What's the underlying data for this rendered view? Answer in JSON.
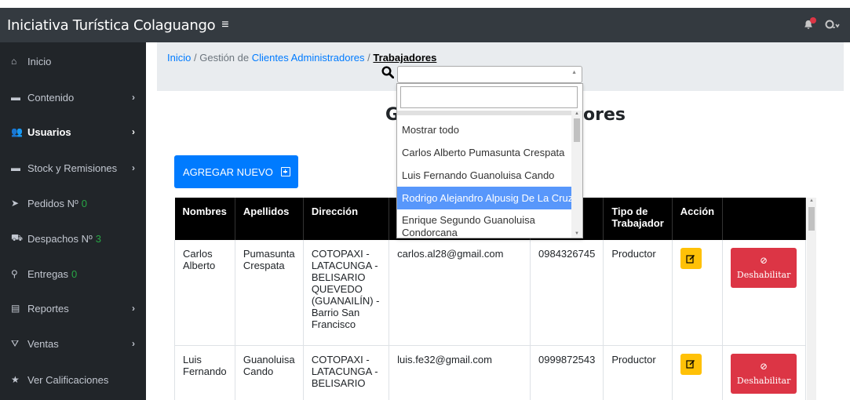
{
  "app": {
    "title": "Iniciativa Turística Colaguango",
    "menu_icon": "≡"
  },
  "sidebar": {
    "items": [
      {
        "label": "Inicio",
        "icon": "home-icon",
        "glyph": "⌂",
        "chevron": ""
      },
      {
        "label": "Contenido",
        "icon": "folder-icon",
        "glyph": "▬",
        "chevron": "›"
      },
      {
        "label": "Usuarios",
        "icon": "users-icon",
        "glyph": "👥",
        "chevron": "›",
        "active": true
      },
      {
        "label": "Stock y Remisiones",
        "icon": "folder-icon",
        "glyph": "▬",
        "chevron": "›"
      },
      {
        "label": "Pedidos Nº",
        "count": "0",
        "icon": "send-icon",
        "glyph": "➤",
        "chevron": ""
      },
      {
        "label": "Despachos Nº",
        "count": "3",
        "icon": "dolly-icon",
        "glyph": "⛟",
        "chevron": ""
      },
      {
        "label": "Entregas",
        "count": "0",
        "icon": "motorcycle-icon",
        "glyph": "⚲",
        "chevron": ""
      },
      {
        "label": "Reportes",
        "icon": "report-icon",
        "glyph": "▤",
        "chevron": "›"
      },
      {
        "label": "Ventas",
        "icon": "cart-icon",
        "glyph": "⛛",
        "chevron": "›"
      },
      {
        "label": "Ver Calificaciones",
        "icon": "star-icon",
        "glyph": "★",
        "chevron": ""
      }
    ]
  },
  "breadcrumb": {
    "home": "Inicio",
    "sep1": "/",
    "section": "Gestión de",
    "link1": "Clientes",
    "link2": "Administradores",
    "sep2": "/",
    "current": "Trabajadores"
  },
  "dropdown": {
    "options": [
      "Mostrar todo",
      "Carlos Alberto Pumasunta Crespata",
      "Luis Fernando Guanoluisa Cando",
      "Rodrigo Alejandro Alpusig De La Cruz",
      "Enrique Segundo Guanoluisa Condorcana"
    ],
    "highlighted_index": 3
  },
  "heading": {
    "left": "G",
    "right": "ores"
  },
  "add_button": {
    "label": "AGREGAR NUEVO"
  },
  "table": {
    "headers": [
      "Nombres",
      "Apellidos",
      "Dirección",
      "",
      "no",
      "Tipo de Trabajador",
      "Acción",
      ""
    ],
    "rows": [
      {
        "nombres": "Carlos Alberto",
        "apellidos": "Pumasunta Crespata",
        "direccion": "COTOPAXI - LATACUNGA - BELISARIO QUEVEDO (GUANAILÍN) - Barrio San Francisco",
        "email": "carlos.al28@gmail.com",
        "telefono": "0984326745",
        "tipo": "Productor",
        "disable_label": "Deshabilitar"
      },
      {
        "nombres": "Luis Fernando",
        "apellidos": "Guanoluisa Cando",
        "direccion": "COTOPAXI - LATACUNGA - BELISARIO",
        "email": "luis.fe32@gmail.com",
        "telefono": "0999872543",
        "tipo": "Productor",
        "disable_label": "Deshabilitar"
      }
    ]
  },
  "colors": {
    "topbar": "#343a40",
    "sidebar": "#212529",
    "primary": "#007bff",
    "danger": "#dc3545",
    "warning": "#ffc107",
    "success": "#28a745",
    "highlight": "#5897fb"
  }
}
